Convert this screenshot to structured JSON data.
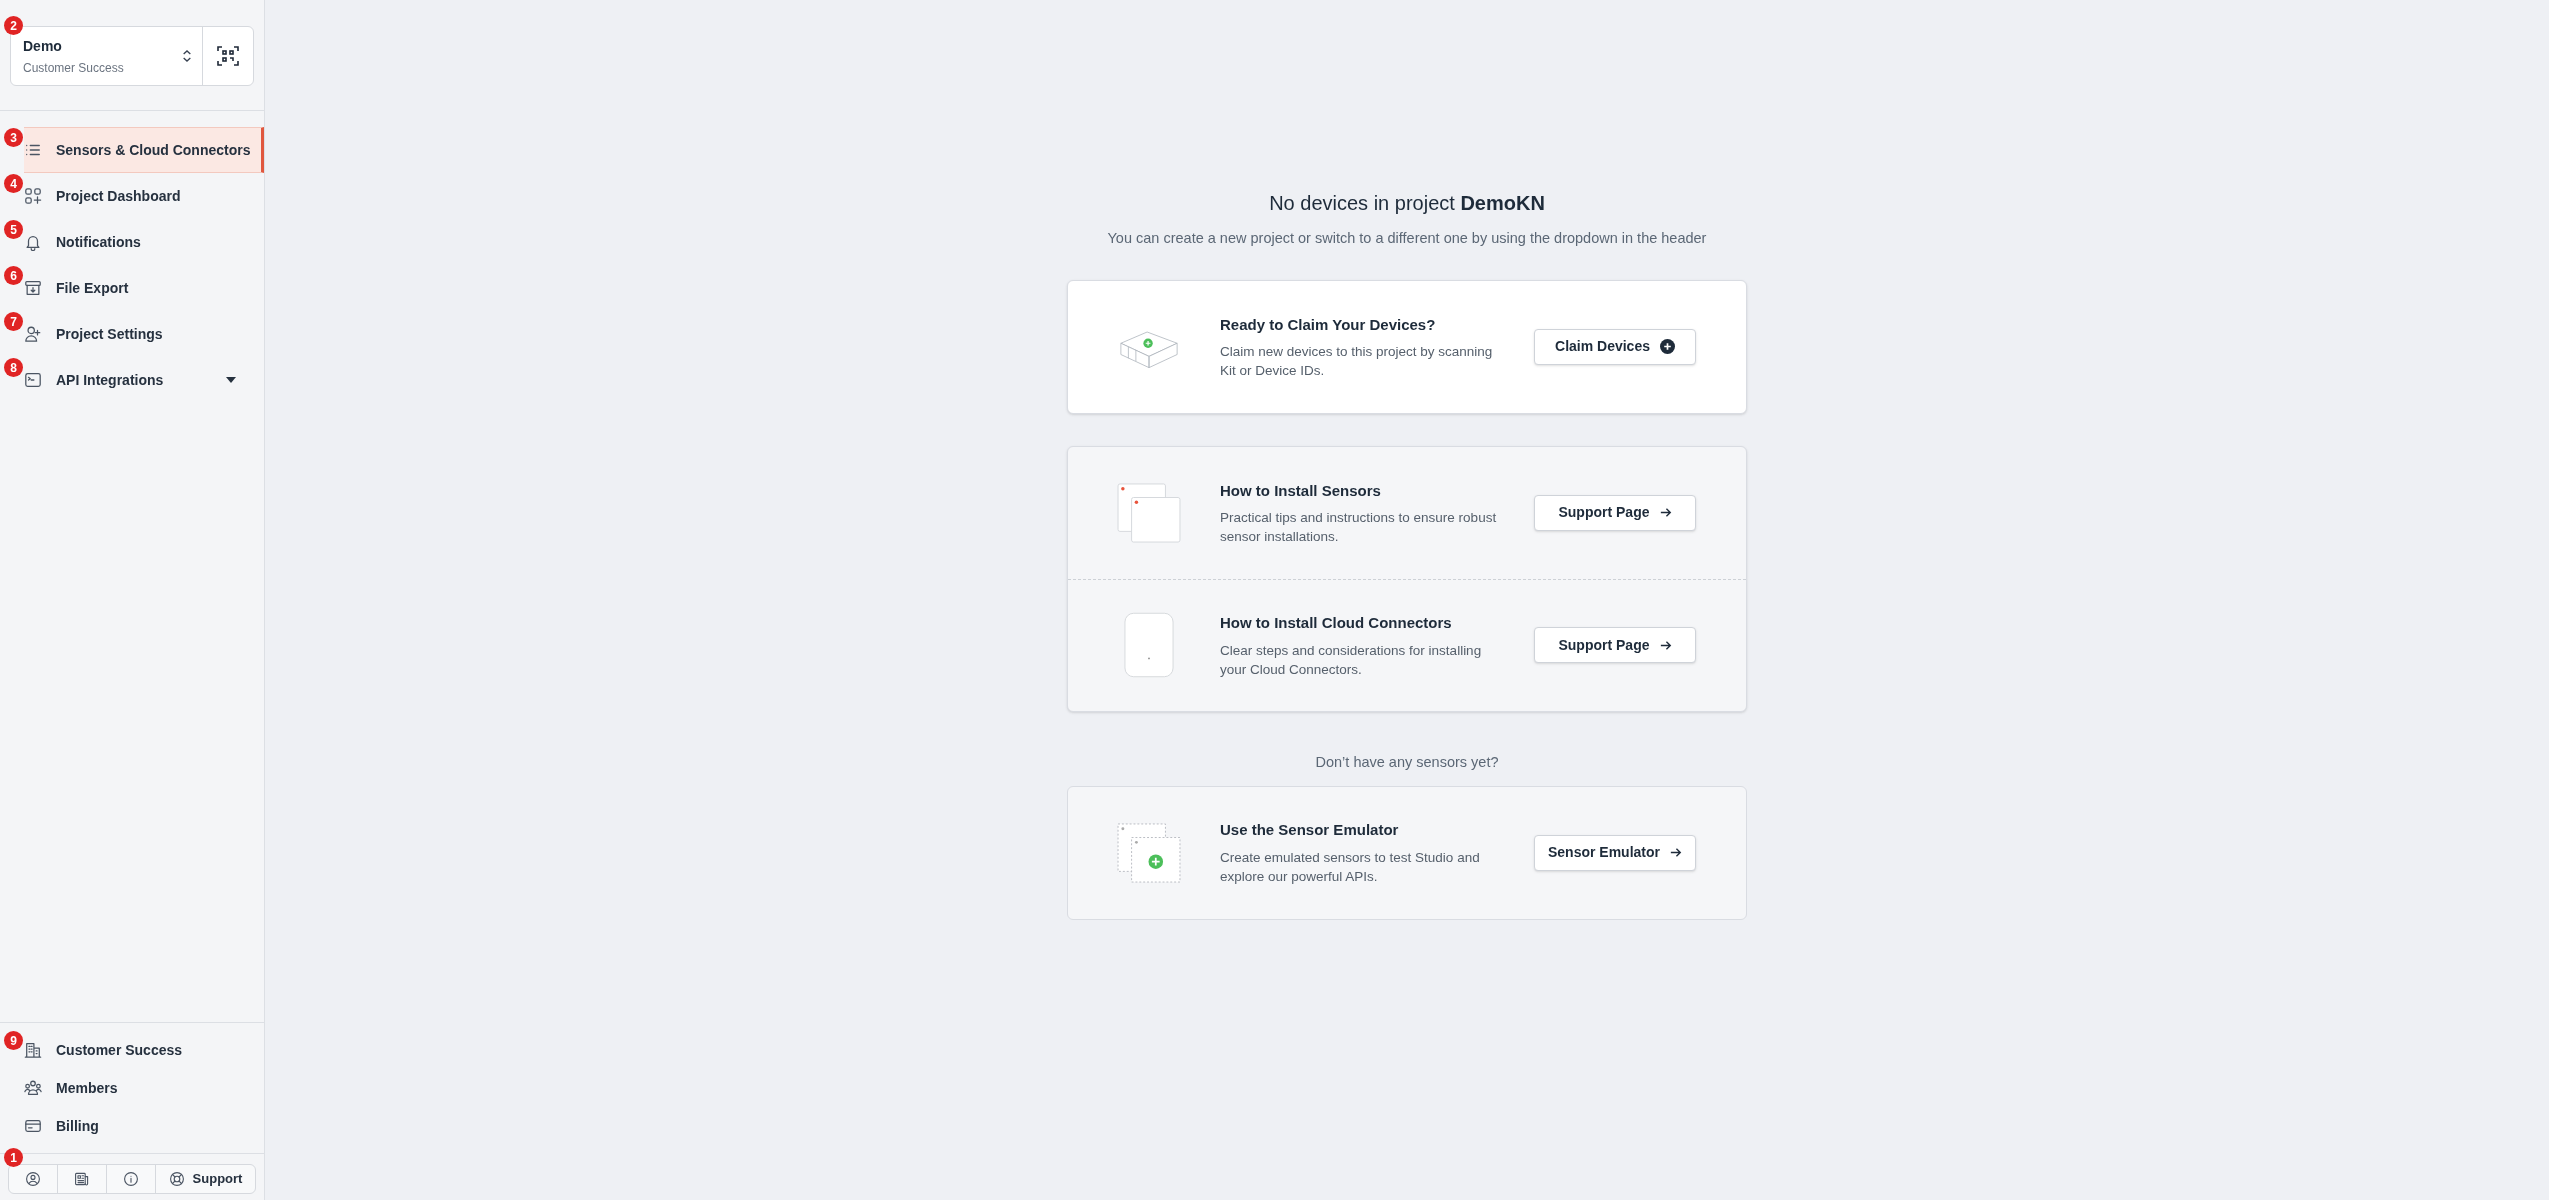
{
  "project_selector": {
    "badge": "2",
    "project": "Demo",
    "organization": "Customer Success"
  },
  "nav": [
    {
      "badge": "3",
      "label": "Sensors & Cloud Connectors",
      "selected": true,
      "has_caret": false
    },
    {
      "badge": "4",
      "label": "Project Dashboard",
      "selected": false,
      "has_caret": false
    },
    {
      "badge": "5",
      "label": "Notifications",
      "selected": false,
      "has_caret": false
    },
    {
      "badge": "6",
      "label": "File Export",
      "selected": false,
      "has_caret": false
    },
    {
      "badge": "7",
      "label": "Project Settings",
      "selected": false,
      "has_caret": false
    },
    {
      "badge": "8",
      "label": "API Integrations",
      "selected": false,
      "has_caret": true
    }
  ],
  "org_nav": [
    {
      "badge": "9",
      "label": "Customer Success"
    },
    {
      "label": "Members"
    },
    {
      "label": "Billing"
    }
  ],
  "footer": {
    "badge": "1",
    "support_label": "Support"
  },
  "main": {
    "heading": "No devices in project **DemoKN**",
    "subtitle": "You can create a new project or switch to a different one by using the dropdown in the header",
    "claim_card": {
      "title": "Ready to Claim Your Devices?",
      "description": "Claim new devices to this project by scanning Kit or Device IDs.",
      "button": "Claim Devices"
    },
    "guides": [
      {
        "kind": "sensors",
        "title": "How to Install Sensors",
        "description": "Practical tips and instructions to ensure robust sensor installations.",
        "button": "Support Page"
      },
      {
        "kind": "connectors",
        "title": "How to Install Cloud Connectors",
        "description": "Clear steps and considerations for installing your Cloud Connectors.",
        "button": "Support Page"
      }
    ],
    "emulator_prompt": "Don’t have any sensors yet?",
    "emulator_card": {
      "title": "Use the Sensor Emulator",
      "description": "Create emulated sensors to test Studio and explore our powerful APIs.",
      "button": "Sensor Emulator"
    }
  }
}
